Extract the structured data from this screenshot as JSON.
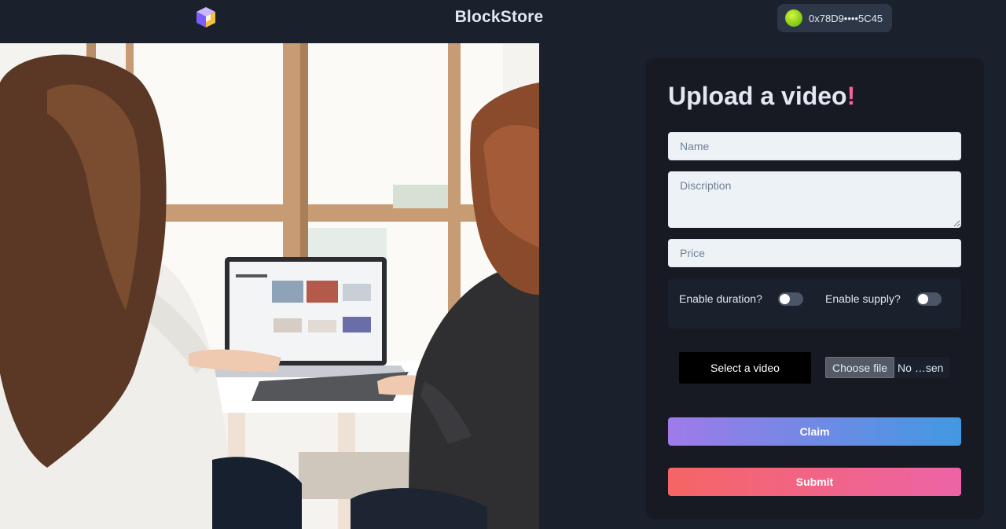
{
  "header": {
    "logo_icon": "cube-logo-icon",
    "brand": "BlockStore",
    "wallet": {
      "avatar_icon": "wallet-avatar-icon",
      "address": "0x78D9••••5C45"
    }
  },
  "hero": {
    "image": "two-women-at-laptop-photo"
  },
  "form": {
    "title": "Upload a video",
    "title_accent": "!",
    "name_placeholder": "Name",
    "description_placeholder": "Discription",
    "price_placeholder": "Price",
    "toggles": {
      "duration_label": "Enable duration?",
      "duration_on": false,
      "supply_label": "Enable supply?",
      "supply_on": false
    },
    "select_video_label": "Select a video",
    "file_button_label": "Choose file",
    "file_status": "No …sen",
    "claim_label": "Claim",
    "submit_label": "Submit"
  },
  "colors": {
    "background": "#1a202c",
    "card": "#171923",
    "accent_pink": "#f56596",
    "claim_gradient": [
      "#9f7aea",
      "#4299e1"
    ],
    "submit_gradient": [
      "#f56565",
      "#ed64a6"
    ]
  }
}
